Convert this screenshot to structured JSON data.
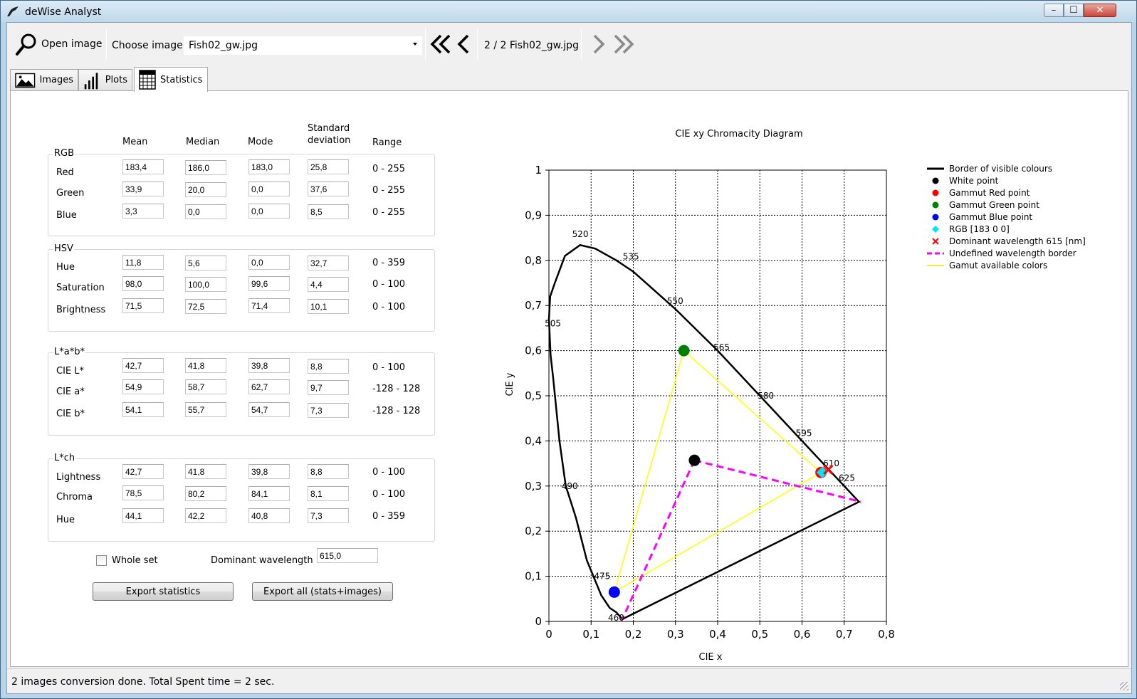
{
  "window": {
    "title": "deWise Analyst"
  },
  "toolbar": {
    "open_image_label": "Open image",
    "choose_image_label": "Choose image",
    "selected_image": "Fish02_gw.jpg",
    "page_indicator": "2 / 2  Fish02_gw.jpg"
  },
  "tabs": [
    {
      "label": "Images",
      "icon": "image-icon"
    },
    {
      "label": "Plots",
      "icon": "bar-chart-icon"
    },
    {
      "label": "Statistics",
      "icon": "table-icon",
      "active": true
    }
  ],
  "stats": {
    "headers": {
      "mean": "Mean",
      "median": "Median",
      "mode": "Mode",
      "std1": "Standard",
      "std2": "deviation",
      "range": "Range"
    },
    "groups": [
      {
        "title": "RGB",
        "rows": [
          {
            "label": "Red",
            "mean": "183,4",
            "median": "186,0",
            "mode": "183,0",
            "std": "25,8",
            "range": "0 - 255"
          },
          {
            "label": "Green",
            "mean": "33,9",
            "median": "20,0",
            "mode": "0,0",
            "std": "37,6",
            "range": "0 - 255"
          },
          {
            "label": "Blue",
            "mean": "3,3",
            "median": "0,0",
            "mode": "0,0",
            "std": "8,5",
            "range": "0 - 255"
          }
        ]
      },
      {
        "title": "HSV",
        "rows": [
          {
            "label": "Hue",
            "mean": "11,8",
            "median": "5,6",
            "mode": "0,0",
            "std": "32,7",
            "range": "0 - 359"
          },
          {
            "label": "Saturation",
            "mean": "98,0",
            "median": "100,0",
            "mode": "99,6",
            "std": "4,4",
            "range": "0 - 100"
          },
          {
            "label": "Brightness",
            "mean": "71,5",
            "median": "72,5",
            "mode": "71,4",
            "std": "10,1",
            "range": "0 - 100"
          }
        ]
      },
      {
        "title": "L*a*b*",
        "rows": [
          {
            "label": "CIE L*",
            "mean": "42,7",
            "median": "41,8",
            "mode": "39,8",
            "std": "8,8",
            "range": "0 - 100"
          },
          {
            "label": "CIE a*",
            "mean": "54,9",
            "median": "58,7",
            "mode": "62,7",
            "std": "9,7",
            "range": "-128 - 128"
          },
          {
            "label": "CIE b*",
            "mean": "54,1",
            "median": "55,7",
            "mode": "54,7",
            "std": "7,3",
            "range": "-128 - 128"
          }
        ]
      },
      {
        "title": "L*ch",
        "rows": [
          {
            "label": "Lightness",
            "mean": "42,7",
            "median": "41,8",
            "mode": "39,8",
            "std": "8,8",
            "range": "0 - 100"
          },
          {
            "label": "Chroma",
            "mean": "78,5",
            "median": "80,2",
            "mode": "84,1",
            "std": "8,1",
            "range": "0 - 100"
          },
          {
            "label": "Hue",
            "mean": "44,1",
            "median": "42,2",
            "mode": "40,8",
            "std": "7,3",
            "range": "0 - 359"
          }
        ]
      }
    ],
    "whole_set_label": "Whole set",
    "whole_set_checked": false,
    "dominant_wavelength_label": "Dominant wavelength",
    "dominant_wavelength_value": "615,0",
    "export_stats_label": "Export statistics",
    "export_all_label": "Export all (stats+images)"
  },
  "status": {
    "text": "2 images conversion done. Total Spent time = 2 sec."
  },
  "chart_data": {
    "type": "scatter",
    "title": "CIE xy Chromacity Diagram",
    "xlabel": "CIE x",
    "ylabel": "CIE y",
    "xlim": [
      0,
      0.8
    ],
    "ylim": [
      0,
      1
    ],
    "x_ticks": [
      "0",
      "0,1",
      "0,2",
      "0,3",
      "0,4",
      "0,5",
      "0,6",
      "0,7",
      "0,8"
    ],
    "y_ticks": [
      "0",
      "0,1",
      "0,2",
      "0,3",
      "0,4",
      "0,5",
      "0,6",
      "0,7",
      "0,8",
      "0,9",
      "1"
    ],
    "grid": true,
    "legend_position": "right",
    "legend": [
      {
        "label": "Border of visible colours",
        "kind": "line",
        "color": "#000000"
      },
      {
        "label": "White point",
        "kind": "dot",
        "color": "#000000"
      },
      {
        "label": "Gammut Red point",
        "kind": "dot",
        "color": "#ff0000"
      },
      {
        "label": "Gammut Green point",
        "kind": "dot",
        "color": "#008000"
      },
      {
        "label": "Gammut Blue point",
        "kind": "dot",
        "color": "#0000ff"
      },
      {
        "label": "RGB [183 0 0]",
        "kind": "diamond",
        "color": "#00e5ff"
      },
      {
        "label": "Dominant wavelength 615 [nm]",
        "kind": "cross",
        "color": "#ff0000"
      },
      {
        "label": "Undefined wavelength border",
        "kind": "dash",
        "color": "#ff00ff"
      },
      {
        "label": "Gamut available colors",
        "kind": "line",
        "color": "#ffff00"
      }
    ],
    "spectral_locus": [
      [
        0.174,
        0.005
      ],
      [
        0.16,
        0.02
      ],
      [
        0.144,
        0.03
      ],
      [
        0.124,
        0.058
      ],
      [
        0.09,
        0.135
      ],
      [
        0.064,
        0.23
      ],
      [
        0.04,
        0.3
      ],
      [
        0.025,
        0.4
      ],
      [
        0.01,
        0.54
      ],
      [
        0.004,
        0.59
      ],
      [
        0.0,
        0.67
      ],
      [
        0.003,
        0.72
      ],
      [
        0.014,
        0.75
      ],
      [
        0.038,
        0.81
      ],
      [
        0.074,
        0.834
      ],
      [
        0.11,
        0.826
      ],
      [
        0.16,
        0.8
      ],
      [
        0.2,
        0.775
      ],
      [
        0.3,
        0.692
      ],
      [
        0.4,
        0.6
      ],
      [
        0.5,
        0.5
      ],
      [
        0.6,
        0.4
      ],
      [
        0.7,
        0.3
      ],
      [
        0.735,
        0.265
      ]
    ],
    "wavelength_labels": [
      {
        "text": "460",
        "x": 0.14,
        "y": 0.008
      },
      {
        "text": "475",
        "x": 0.107,
        "y": 0.1
      },
      {
        "text": "490",
        "x": 0.03,
        "y": 0.3
      },
      {
        "text": "505",
        "x": -0.01,
        "y": 0.66
      },
      {
        "text": "520",
        "x": 0.055,
        "y": 0.858
      },
      {
        "text": "535",
        "x": 0.175,
        "y": 0.808
      },
      {
        "text": "550",
        "x": 0.28,
        "y": 0.71
      },
      {
        "text": "565",
        "x": 0.39,
        "y": 0.607
      },
      {
        "text": "580",
        "x": 0.495,
        "y": 0.5
      },
      {
        "text": "595",
        "x": 0.585,
        "y": 0.417
      },
      {
        "text": "610",
        "x": 0.65,
        "y": 0.35
      },
      {
        "text": "625",
        "x": 0.687,
        "y": 0.318
      }
    ],
    "white_point": [
      0.345,
      0.357
    ],
    "gamut_red": [
      0.645,
      0.33
    ],
    "gamut_green": [
      0.32,
      0.6
    ],
    "gamut_blue": [
      0.155,
      0.065
    ],
    "rgb_point": {
      "label": "RGB [183 0 0]",
      "x": 0.648,
      "y": 0.33
    },
    "dominant_wavelength_point": {
      "label": "615",
      "x": 0.662,
      "y": 0.336
    },
    "undefined_border": [
      [
        0.345,
        0.357
      ],
      [
        0.74,
        0.265
      ],
      [
        0.345,
        0.357
      ],
      [
        0.174,
        0.005
      ]
    ]
  }
}
